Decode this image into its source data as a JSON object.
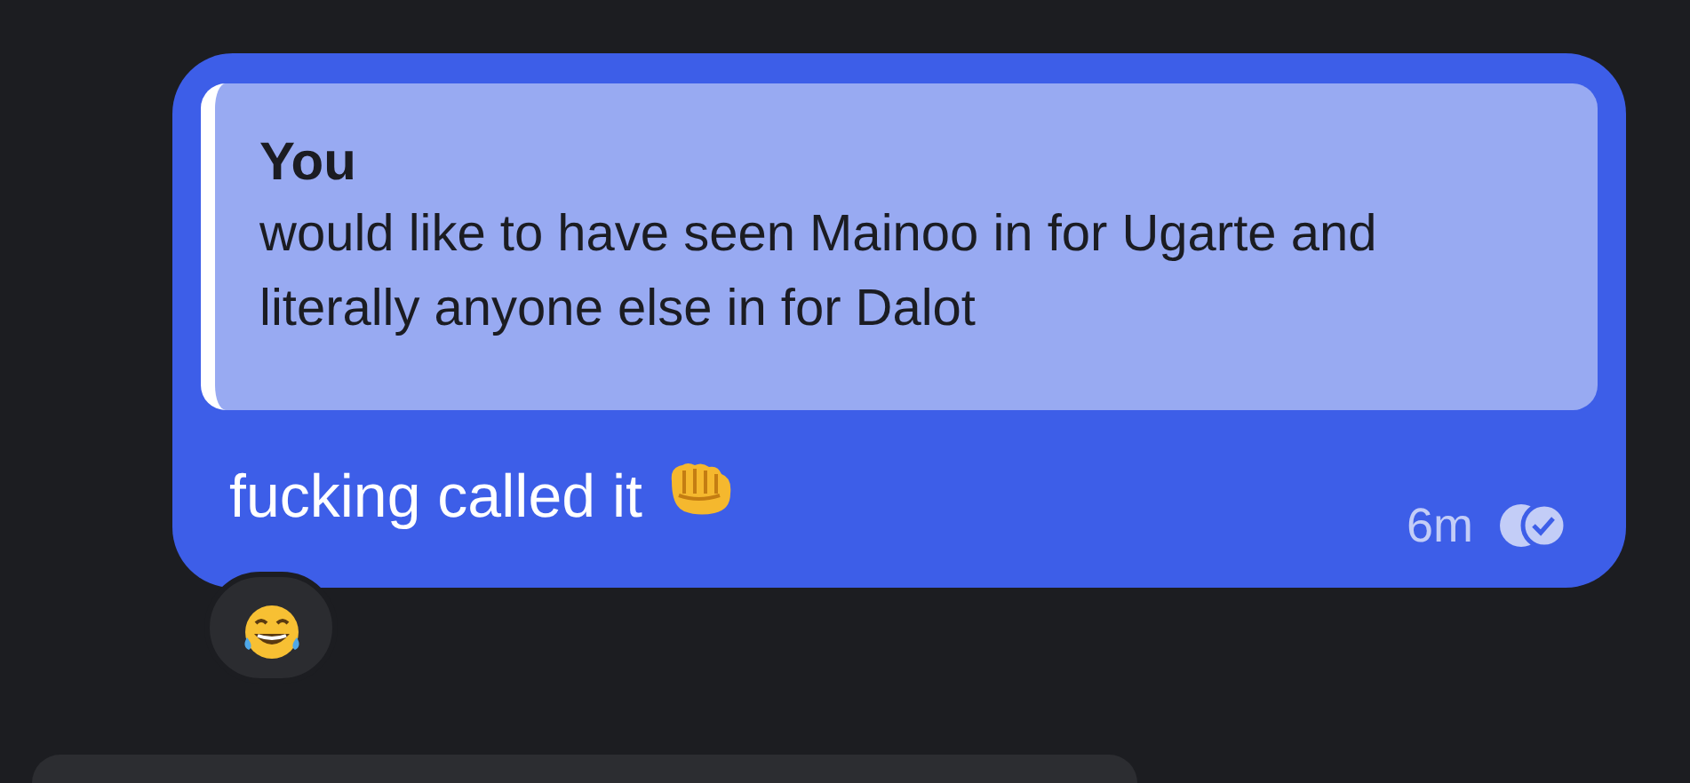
{
  "message": {
    "quote": {
      "author": "You",
      "text": "would like to have seen Mainoo in for Ugarte and literally anyone else in for Dalot"
    },
    "text": "fucking called it",
    "emoji": {
      "kind": "fist"
    },
    "time": "6m",
    "receipt": {
      "kind": "read"
    }
  },
  "reactions": [
    {
      "kind": "laugh"
    }
  ],
  "next_message": {
    "kind": "incoming"
  }
}
